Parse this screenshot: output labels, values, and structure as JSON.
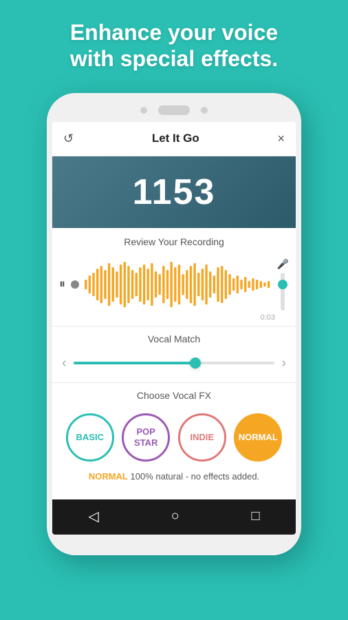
{
  "header": {
    "line1": "Enhance your voice",
    "line2": "with special effects."
  },
  "titleBar": {
    "title": "Let It Go",
    "backIcon": "↺",
    "closeIcon": "×"
  },
  "score": {
    "value": "1153"
  },
  "reviewSection": {
    "label": "Review Your Recording",
    "timeLabel": "0:03",
    "playIcon": "⏸"
  },
  "vocalMatch": {
    "label": "Vocal Match",
    "leftArrow": "‹",
    "rightArrow": "›"
  },
  "chooseFX": {
    "label": "Choose Vocal FX",
    "circles": [
      {
        "id": "basic",
        "label": "BASIC",
        "style": "basic"
      },
      {
        "id": "pop-star",
        "label": "POP\nSTAR",
        "style": "pop-star"
      },
      {
        "id": "indie",
        "label": "INDIE",
        "style": "indie"
      },
      {
        "id": "normal",
        "label": "NORMAL",
        "style": "normal"
      }
    ],
    "selectedName": "NORMAL",
    "selectedDesc": "100% natural - no effects added."
  },
  "phoneNav": {
    "backIcon": "◁",
    "homeIcon": "○",
    "recentIcon": "□"
  },
  "colors": {
    "teal": "#2bbfb3",
    "darkTeal": "#1a9a8f",
    "background": "#2bbfb3",
    "orange": "#f5a623",
    "purple": "#9b59b6",
    "pink": "#e07878"
  }
}
